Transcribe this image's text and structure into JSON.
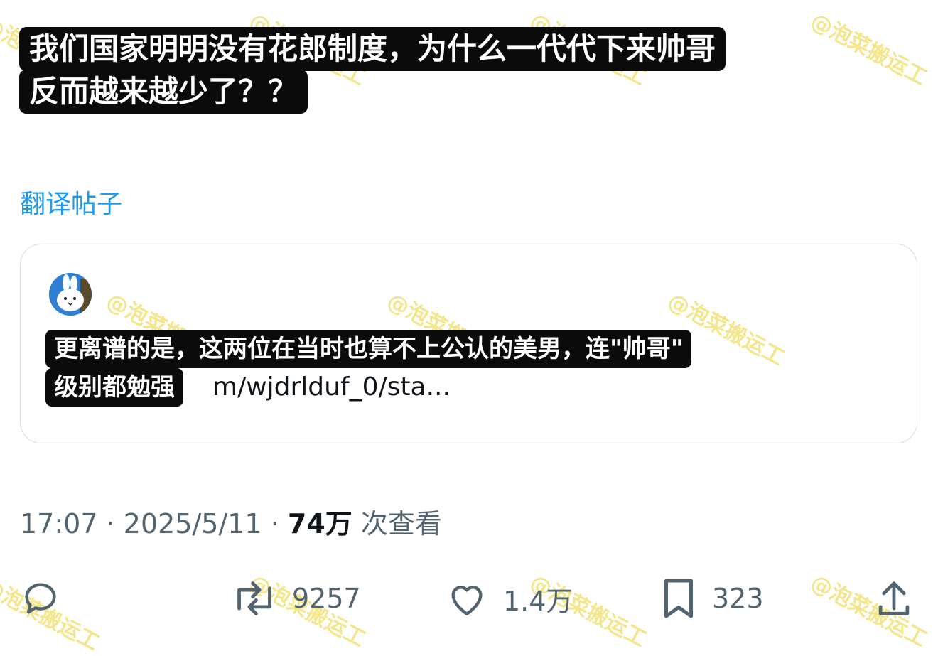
{
  "post": {
    "caption_lines": [
      "我们国家明明没有花郎制度，为什么一代代下来帅哥",
      "反而越来越少了？？"
    ],
    "translate_link": "翻译帖子"
  },
  "quoted_post": {
    "caption_lines": [
      "更离谱的是，这两位在当时也算不上公认的美男，连\"帅哥\"",
      "级别都勉强"
    ],
    "url_text": "m/wjdrlduf_0/sta..."
  },
  "meta": {
    "time": "17:07",
    "separator": "·",
    "date": "2025/5/11",
    "views_count": "74万",
    "views_label": "次查看"
  },
  "actions": {
    "retweet_count": "9257",
    "like_count": "1.4万",
    "bookmark_count": "323"
  },
  "watermark": "@泡菜搬运工",
  "colors": {
    "link": "#1d9bf0",
    "muted_text": "#536471",
    "caption_bg": "#0b0b0b",
    "watermark": "#f2e27a"
  }
}
